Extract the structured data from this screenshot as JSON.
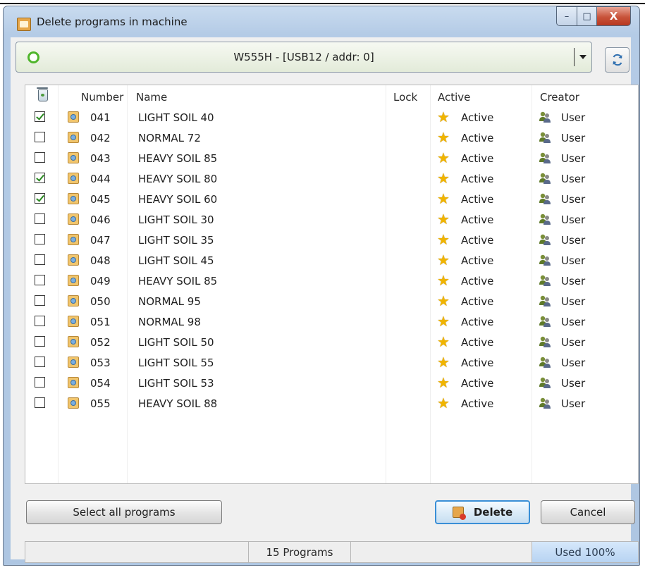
{
  "window": {
    "title": "Delete programs in machine",
    "controls": {
      "minimize": "–",
      "maximize": "□",
      "close": "X"
    }
  },
  "machine_select": {
    "value": "W555H - [USB12 / addr: 0]",
    "status_color": "#4fb52b"
  },
  "columns": {
    "number": "Number",
    "name": "Name",
    "lock": "Lock",
    "active": "Active",
    "creator": "Creator"
  },
  "programs": [
    {
      "checked": true,
      "number": "041",
      "name": "LIGHT SOIL 40",
      "active": "Active",
      "creator": "User"
    },
    {
      "checked": false,
      "number": "042",
      "name": "NORMAL 72",
      "active": "Active",
      "creator": "User"
    },
    {
      "checked": false,
      "number": "043",
      "name": "HEAVY SOIL 85",
      "active": "Active",
      "creator": "User"
    },
    {
      "checked": true,
      "number": "044",
      "name": "HEAVY SOIL 80",
      "active": "Active",
      "creator": "User"
    },
    {
      "checked": true,
      "number": "045",
      "name": "HEAVY SOIL 60",
      "active": "Active",
      "creator": "User"
    },
    {
      "checked": false,
      "number": "046",
      "name": "LIGHT SOIL 30",
      "active": "Active",
      "creator": "User"
    },
    {
      "checked": false,
      "number": "047",
      "name": "LIGHT SOIL 35",
      "active": "Active",
      "creator": "User"
    },
    {
      "checked": false,
      "number": "048",
      "name": "LIGHT SOIL 45",
      "active": "Active",
      "creator": "User"
    },
    {
      "checked": false,
      "number": "049",
      "name": "HEAVY SOIL 85",
      "active": "Active",
      "creator": "User"
    },
    {
      "checked": false,
      "number": "050",
      "name": "NORMAL 95",
      "active": "Active",
      "creator": "User"
    },
    {
      "checked": false,
      "number": "051",
      "name": "NORMAL 98",
      "active": "Active",
      "creator": "User"
    },
    {
      "checked": false,
      "number": "052",
      "name": "LIGHT SOIL 50",
      "active": "Active",
      "creator": "User"
    },
    {
      "checked": false,
      "number": "053",
      "name": "LIGHT SOIL 55",
      "active": "Active",
      "creator": "User"
    },
    {
      "checked": false,
      "number": "054",
      "name": "LIGHT SOIL 53",
      "active": "Active",
      "creator": "User"
    },
    {
      "checked": false,
      "number": "055",
      "name": "HEAVY SOIL 88",
      "active": "Active",
      "creator": "User"
    }
  ],
  "buttons": {
    "select_all": "Select all programs",
    "delete": "Delete",
    "cancel": "Cancel"
  },
  "status": {
    "count": "15 Programs",
    "used": "Used 100%"
  },
  "icons": {
    "app": "program-delete-icon",
    "refresh": "refresh-icon",
    "header_select": "trash-icon",
    "program": "program-file-icon",
    "active": "star-icon",
    "creator": "users-icon"
  },
  "colors": {
    "accent": "#3a8fd6",
    "title_bar": "#b4cbe6",
    "status_used": "#b7d3f2"
  }
}
